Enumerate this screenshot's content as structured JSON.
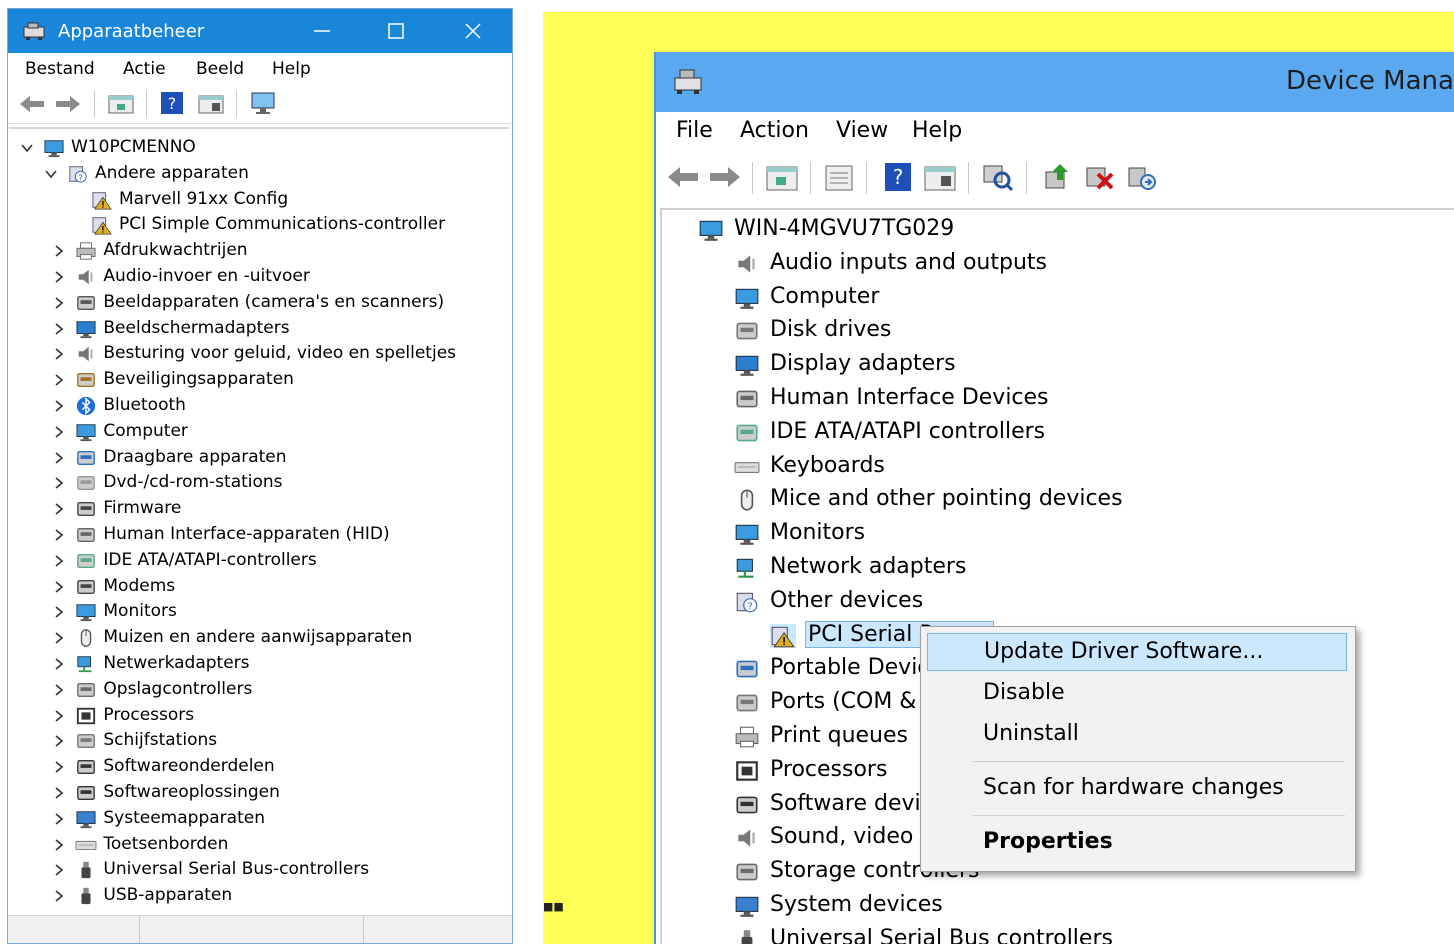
{
  "left_window": {
    "title": "Apparaatbeheer",
    "menu": [
      "Bestand",
      "Actie",
      "Beeld",
      "Help"
    ],
    "computer_name": "W10PCMENNO",
    "expanded_category": "Andere apparaten",
    "expanded_children": [
      "Marvell 91xx Config",
      "PCI Simple Communications-controller"
    ],
    "categories": [
      "Afdrukwachtrijen",
      "Audio-invoer en -uitvoer",
      "Beeldapparaten (camera's en scanners)",
      "Beeldschermadapters",
      "Besturing voor geluid, video en spelletjes",
      "Beveiligingsapparaten",
      "Bluetooth",
      "Computer",
      "Draagbare apparaten",
      "Dvd-/cd-rom-stations",
      "Firmware",
      "Human Interface-apparaten (HID)",
      "IDE ATA/ATAPI-controllers",
      "Modems",
      "Monitors",
      "Muizen en andere aanwijsapparaten",
      "Netwerkadapters",
      "Opslagcontrollers",
      "Processors",
      "Schijfstations",
      "Softwareonderdelen",
      "Softwareoplossingen",
      "Systeemapparaten",
      "Toetsenborden",
      "Universal Serial Bus-controllers",
      "USB-apparaten"
    ],
    "icons": [
      "printer-icon",
      "speaker-icon",
      "camera-icon",
      "display-adapter-icon",
      "speaker-icon",
      "security-icon",
      "bluetooth-icon",
      "computer-icon",
      "portable-device-icon",
      "dvd-icon",
      "firmware-icon",
      "hid-icon",
      "ide-icon",
      "modem-icon",
      "monitor-icon",
      "mouse-icon",
      "network-icon",
      "storage-icon",
      "processor-icon",
      "disk-icon",
      "software-component-icon",
      "software-icon",
      "system-icon",
      "keyboard-icon",
      "usb-icon",
      "usb-icon"
    ]
  },
  "right_window": {
    "title": "Device Mana",
    "menu": [
      "File",
      "Action",
      "View",
      "Help"
    ],
    "computer_name": "WIN-4MGVU7TG029",
    "categories": [
      {
        "label": "Audio inputs and outputs",
        "icon": "speaker-icon",
        "expanded": false
      },
      {
        "label": "Computer",
        "icon": "computer-icon",
        "expanded": false
      },
      {
        "label": "Disk drives",
        "icon": "disk-icon",
        "expanded": false
      },
      {
        "label": "Display adapters",
        "icon": "display-adapter-icon",
        "expanded": false
      },
      {
        "label": "Human Interface Devices",
        "icon": "hid-icon",
        "expanded": false
      },
      {
        "label": "IDE ATA/ATAPI controllers",
        "icon": "ide-icon",
        "expanded": false
      },
      {
        "label": "Keyboards",
        "icon": "keyboard-icon",
        "expanded": false
      },
      {
        "label": "Mice and other pointing devices",
        "icon": "mouse-icon",
        "expanded": false
      },
      {
        "label": "Monitors",
        "icon": "monitor-icon",
        "expanded": false
      },
      {
        "label": "Network adapters",
        "icon": "network-icon",
        "expanded": false
      },
      {
        "label": "Other devices",
        "icon": "unknown-device-icon",
        "expanded": true
      },
      {
        "label": "PCI Serial P",
        "icon": "warning-device-icon",
        "child": true
      },
      {
        "label": "Portable Devic",
        "icon": "portable-device-icon",
        "expanded": false
      },
      {
        "label": "Ports (COM &",
        "icon": "port-icon",
        "expanded": false
      },
      {
        "label": "Print queues",
        "icon": "printer-icon",
        "expanded": false
      },
      {
        "label": "Processors",
        "icon": "processor-icon",
        "expanded": false
      },
      {
        "label": "Software devic",
        "icon": "software-icon",
        "expanded": false
      },
      {
        "label": "Sound, video a",
        "icon": "speaker-icon",
        "expanded": false
      },
      {
        "label": "Storage controllers",
        "icon": "storage-icon",
        "expanded": false
      },
      {
        "label": "System devices",
        "icon": "system-icon",
        "expanded": false
      },
      {
        "label": "Universal Serial Bus controllers",
        "icon": "usb-icon",
        "expanded": true
      }
    ],
    "context_menu": {
      "update": "Update Driver Software...",
      "disable": "Disable",
      "uninstall": "Uninstall",
      "scan": "Scan for hardware changes",
      "properties": "Properties"
    }
  },
  "colors": {
    "title_blue": "#1a86d9",
    "right_title_blue": "#5aa9f0",
    "desktop_yellow": "#ffff55",
    "highlight": "#cce8ff"
  }
}
